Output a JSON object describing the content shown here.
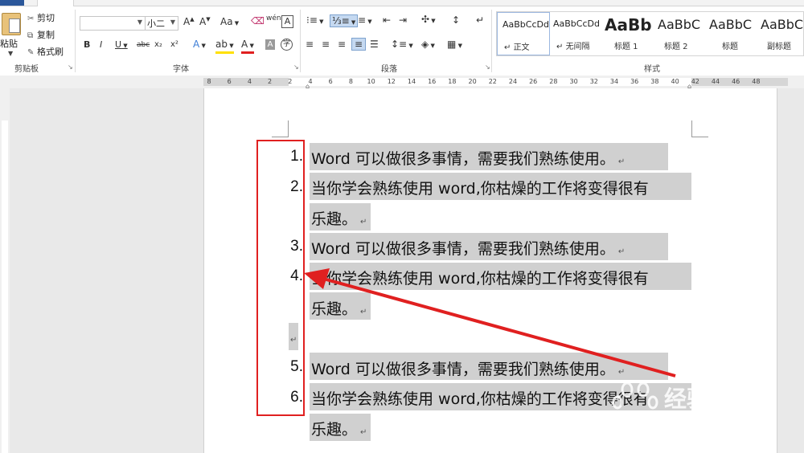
{
  "clipboard": {
    "paste_label": "粘贴",
    "cut_label": "剪切",
    "copy_label": "复制",
    "format_painter_label": "格式刷",
    "group_label": "剪贴板"
  },
  "font": {
    "font_name": "",
    "font_size": "小二",
    "bold": "B",
    "italic": "I",
    "underline": "U",
    "strike": "abc",
    "subscript": "x₂",
    "superscript": "x²",
    "change_case": "Aa",
    "wen": "wén",
    "box_char": "A",
    "group_label": "字体"
  },
  "paragraph": {
    "group_label": "段落"
  },
  "styles": {
    "group_label": "样式",
    "items": [
      {
        "preview": "AaBbCcDd",
        "name": "正文"
      },
      {
        "preview": "AaBbCcDd",
        "name": "无间隔"
      },
      {
        "preview": "AaBb",
        "name": "标题 1"
      },
      {
        "preview": "AaBbC",
        "name": "标题 2"
      },
      {
        "preview": "AaBbC",
        "name": "标题"
      },
      {
        "preview": "AaBbC",
        "name": "副标题"
      }
    ]
  },
  "ruler": {
    "marks": [
      "8",
      "6",
      "4",
      "2",
      "2",
      "4",
      "6",
      "8",
      "10",
      "12",
      "14",
      "16",
      "18",
      "20",
      "22",
      "24",
      "26",
      "28",
      "30",
      "32",
      "34",
      "36",
      "38",
      "40",
      "42",
      "44",
      "46",
      "48"
    ]
  },
  "document": {
    "items": [
      {
        "num": "1.",
        "text": "Word 可以做很多事情，需要我们熟练使用。",
        "wrap": ""
      },
      {
        "num": "2.",
        "text": "当你学会熟练使用 word,你枯燥的工作将变得很有",
        "wrap": "乐趣。"
      },
      {
        "num": "3.",
        "text": "Word 可以做很多事情，需要我们熟练使用。",
        "wrap": ""
      },
      {
        "num": "4.",
        "text": "当你学会熟练使用 word,你枯燥的工作将变得很有",
        "wrap": "乐趣。"
      },
      {
        "num": "5.",
        "text": "Word 可以做很多事情，需要我们熟练使用。",
        "wrap": ""
      },
      {
        "num": "6.",
        "text": "当你学会熟练使用 word,你枯燥的工作将变得很有",
        "wrap": "乐趣。"
      }
    ],
    "paragraph_mark": "↵"
  },
  "watermark": {
    "text": "经验",
    "url": "jingyan.baidu.com"
  },
  "colors": {
    "annotation_red": "#e02020",
    "selection_gray": "#d0d0d0",
    "word_blue": "#2b579a"
  }
}
